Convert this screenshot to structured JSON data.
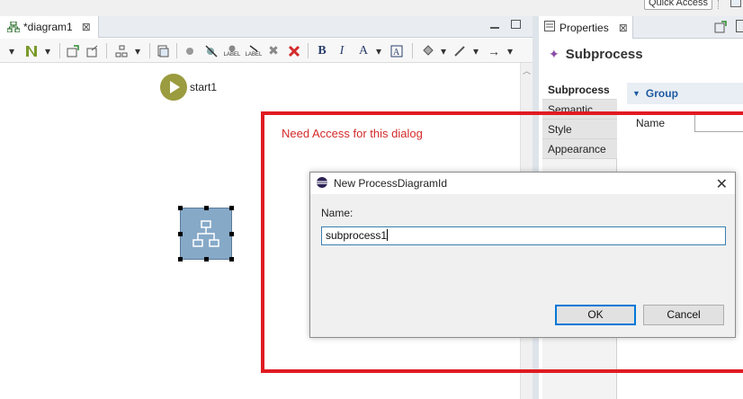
{
  "top": {
    "quick_access_label": "Quick Access"
  },
  "editor": {
    "tab_label": "*diagram1",
    "tab_close": "⊠"
  },
  "toolbar": {
    "bold": "B",
    "italic": "I",
    "font_color": "A",
    "arrow": "→",
    "label_text": "LABEL"
  },
  "canvas": {
    "start_label": "start1",
    "subprocess_icon": "hierarchy-icon"
  },
  "properties": {
    "tab_label": "Properties",
    "tab_close": "⊠",
    "title": "Subprocess",
    "side_tabs": [
      "Subprocess",
      "Semantic",
      "Style",
      "Appearance"
    ],
    "group_label": "Group",
    "name_label": "Name"
  },
  "annotation": {
    "note": "Need Access for this dialog",
    "frame_color": "#e01b22"
  },
  "dialog": {
    "title": "New ProcessDiagramId",
    "close": "✕",
    "name_label": "Name:",
    "name_value": "subprocess1",
    "ok_label": "OK",
    "cancel_label": "Cancel"
  }
}
